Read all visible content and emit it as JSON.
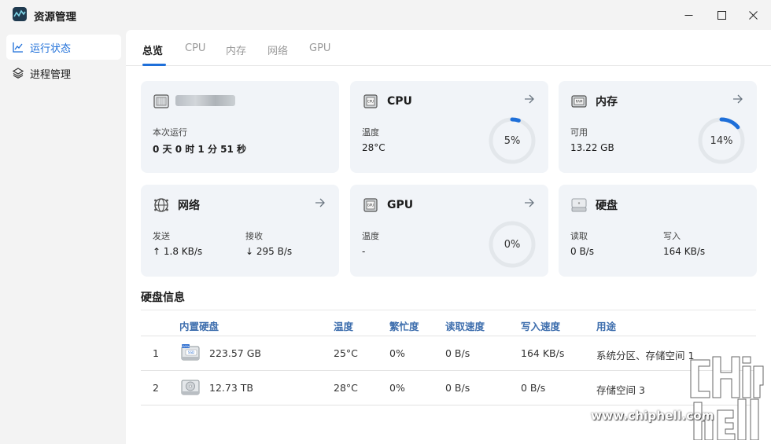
{
  "app": {
    "title": "资源管理"
  },
  "window_controls": {
    "minimize": "—",
    "maximize": "☐",
    "close": "✕"
  },
  "sidebar": {
    "items": [
      {
        "label": "运行状态",
        "icon": "line-chart-icon",
        "active": true
      },
      {
        "label": "进程管理",
        "icon": "layers-icon",
        "active": false
      }
    ]
  },
  "tabs": [
    {
      "label": "总览",
      "active": true
    },
    {
      "label": "CPU",
      "active": false
    },
    {
      "label": "内存",
      "active": false
    },
    {
      "label": "网络",
      "active": false
    },
    {
      "label": "GPU",
      "active": false
    }
  ],
  "cards": {
    "system": {
      "uptime_label": "本次运行",
      "uptime_value": "0 天 0 时 1 分 51 秒"
    },
    "cpu": {
      "title": "CPU",
      "temp_label": "温度",
      "temp_value": "28°C",
      "usage_text": "5%",
      "usage_fraction": 0.05
    },
    "memory": {
      "title": "内存",
      "avail_label": "可用",
      "avail_value": "13.22 GB",
      "usage_text": "14%",
      "usage_fraction": 0.14
    },
    "network": {
      "title": "网络",
      "send_label": "发送",
      "send_value": "↑ 1.8 KB/s",
      "recv_label": "接收",
      "recv_value": "↓ 295 B/s"
    },
    "gpu": {
      "title": "GPU",
      "temp_label": "温度",
      "temp_value": "-",
      "usage_text": "0%",
      "usage_fraction": 0.0
    },
    "disk": {
      "title": "硬盘",
      "read_label": "读取",
      "read_value": "0 B/s",
      "write_label": "写入",
      "write_value": "164 KB/s"
    }
  },
  "disk_info": {
    "title": "硬盘信息",
    "columns": [
      "内置硬盘",
      "温度",
      "繁忙度",
      "读取速度",
      "写入速度",
      "用途"
    ],
    "rows": [
      {
        "index": "1",
        "icon": "nvme-ssd-icon",
        "size": "223.57 GB",
        "temp": "25°C",
        "busy": "0%",
        "read": "0 B/s",
        "write": "164 KB/s",
        "usage": "系统分区、存储空间 1"
      },
      {
        "index": "2",
        "icon": "hdd-icon",
        "size": "12.73 TB",
        "temp": "28°C",
        "busy": "0%",
        "read": "0 B/s",
        "write": "0 B/s",
        "usage": "存储空间 3"
      }
    ]
  },
  "watermark": {
    "text": "www.chiphell.com"
  },
  "colors": {
    "accent": "#1e6fd9",
    "card_bg": "#f1f4f8",
    "ring_track": "#e6eaee"
  }
}
